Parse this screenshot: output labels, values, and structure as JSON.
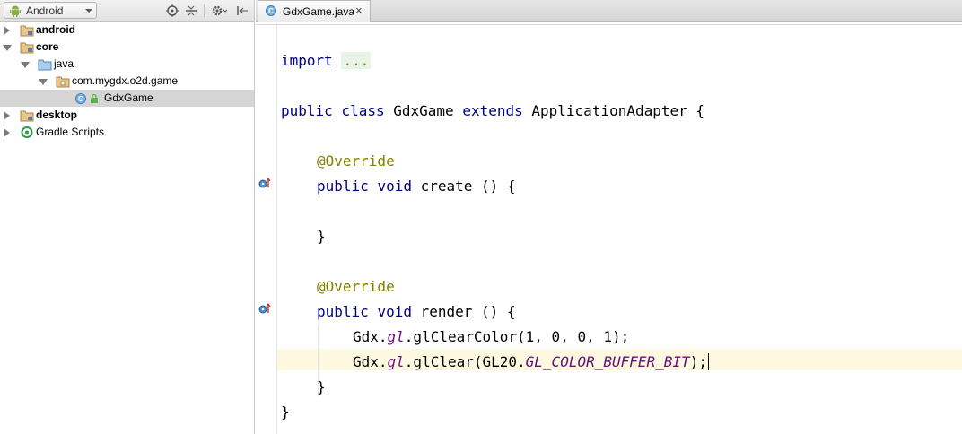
{
  "project_panel": {
    "view_selector": {
      "label": "Android",
      "icon": "android-icon"
    },
    "toolbar_icons": [
      "target-icon",
      "collapse-all-icon",
      "gear-icon",
      "hide-panel-icon"
    ],
    "tree": [
      {
        "label": "android",
        "bold": true,
        "state": "collapsed",
        "icon": "module-folder-icon"
      },
      {
        "label": "core",
        "bold": true,
        "state": "expanded",
        "icon": "module-folder-icon"
      },
      {
        "label": "java",
        "bold": false,
        "state": "expanded",
        "icon": "source-folder-icon"
      },
      {
        "label": "com.mygdx.o2d.game",
        "bold": false,
        "state": "expanded",
        "icon": "package-icon"
      },
      {
        "label": "GdxGame",
        "bold": false,
        "state": "leaf",
        "icon": "class-icon",
        "selected": true
      },
      {
        "label": "desktop",
        "bold": true,
        "state": "collapsed",
        "icon": "module-folder-icon"
      },
      {
        "label": "Gradle Scripts",
        "bold": false,
        "state": "collapsed",
        "icon": "gradle-icon"
      }
    ]
  },
  "editor": {
    "tab": {
      "label": "GdxGame.java",
      "close": "×",
      "icon": "class-icon"
    },
    "code": {
      "import_kw": "import",
      "import_fold": "...",
      "class_public": "public",
      "class_kw": "class",
      "class_name": " GdxGame ",
      "extends_kw": "extends",
      "class_rest": " ApplicationAdapter {",
      "override1": "@Override",
      "create_public": "public",
      "create_void": "void",
      "create_rest": " create () {",
      "create_close": "}",
      "override2": "@Override",
      "render_public": "public",
      "render_void": "void",
      "render_rest": " render () {",
      "l1_a": "Gdx.",
      "l1_gl": "gl",
      "l1_b": ".glClearColor(1, 0, 0, 1);",
      "l2_a": "Gdx.",
      "l2_gl": "gl",
      "l2_b": ".glClear(GL20.",
      "l2_field": "GL_COLOR_BUFFER_BIT",
      "l2_c": ");",
      "render_close": "}",
      "class_close": "}"
    }
  }
}
